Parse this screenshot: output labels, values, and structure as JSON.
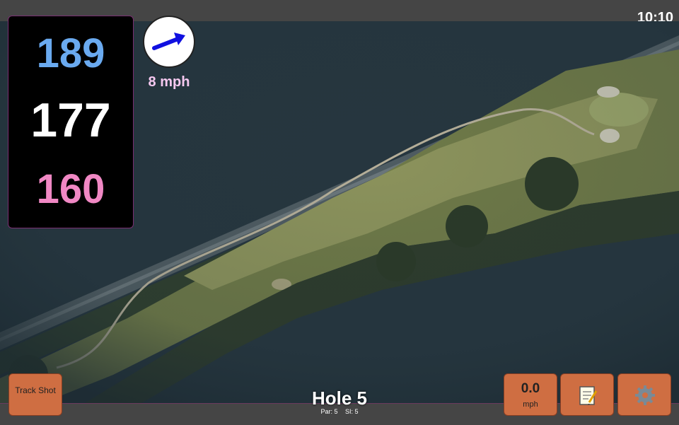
{
  "status": {
    "time": "10:10"
  },
  "distances": {
    "back": "189",
    "middle": "177",
    "front": "160"
  },
  "wind": {
    "speed_label": "8 mph",
    "arrow_icon": "wind-arrow-icon",
    "arrow_color": "#1010e0"
  },
  "hole": {
    "title": "Hole 5",
    "par_label": "Par: 5",
    "si_label": "SI: 5"
  },
  "buttons": {
    "track_shot_label": "Track Shot",
    "speed_value": "0.0",
    "speed_unit": "mph",
    "notes_icon": "notepad-icon",
    "settings_icon": "gear-icon"
  },
  "colors": {
    "back_distance": "#6aaaf0",
    "middle_distance": "#ffffff",
    "front_distance": "#f088c4",
    "button": "#cf6e42",
    "wind_text": "#f5c8f0"
  }
}
